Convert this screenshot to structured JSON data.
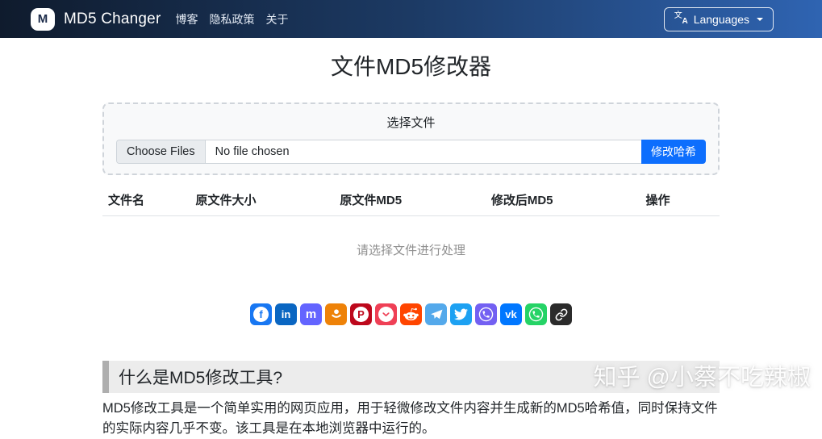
{
  "navbar": {
    "logo_letter": "M",
    "brand": "MD5 Changer",
    "links": [
      "博客",
      "隐私政策",
      "关于"
    ],
    "languages_label": "Languages"
  },
  "page_title": "文件MD5修改器",
  "uploader": {
    "label": "选择文件",
    "choose_files_label": "Choose Files",
    "no_file_text": "No file chosen",
    "submit_label": "修改哈希",
    "submit_color": "#0d6efd"
  },
  "files_table": {
    "headers": [
      "文件名",
      "原文件大小",
      "原文件MD5",
      "修改后MD5",
      "操作"
    ],
    "empty_text": "请选择文件进行处理"
  },
  "share": {
    "buttons": [
      {
        "name": "facebook",
        "icon": "facebook-icon",
        "color": "#1877f2",
        "glyph": "f"
      },
      {
        "name": "linkedin",
        "icon": "linkedin-icon",
        "color": "#0a66c2",
        "glyph": "in"
      },
      {
        "name": "mastodon",
        "icon": "mastodon-icon",
        "color": "#6364ff",
        "glyph": "m"
      },
      {
        "name": "odnoklassniki",
        "icon": "odnoklassniki-icon",
        "color": "#ee8208"
      },
      {
        "name": "pinterest",
        "icon": "pinterest-icon",
        "color": "#bd081c",
        "glyph": "P"
      },
      {
        "name": "pocket",
        "icon": "pocket-icon",
        "color": "#ef4056"
      },
      {
        "name": "reddit",
        "icon": "reddit-icon",
        "color": "#ff4500"
      },
      {
        "name": "telegram",
        "icon": "telegram-icon",
        "color": "#54a9eb"
      },
      {
        "name": "twitter",
        "icon": "twitter-icon",
        "color": "#1da1f2"
      },
      {
        "name": "viber",
        "icon": "viber-icon",
        "color": "#7360f2"
      },
      {
        "name": "vk",
        "icon": "vk-icon",
        "color": "#0077ff",
        "glyph": "vk"
      },
      {
        "name": "whatsapp",
        "icon": "whatsapp-icon",
        "color": "#25d366"
      },
      {
        "name": "copy-link",
        "icon": "link-icon",
        "color": "#2b2b2b"
      }
    ]
  },
  "article": {
    "heading": "什么是MD5修改工具?",
    "paragraph": "MD5修改工具是一个简单实用的网页应用，用于轻微修改文件内容并生成新的MD5哈希值，同时保持文件的实际内容几乎不变。该工具是在本地浏览器中运行的。"
  },
  "watermark": "知乎 @小蔡不吃辣椒"
}
